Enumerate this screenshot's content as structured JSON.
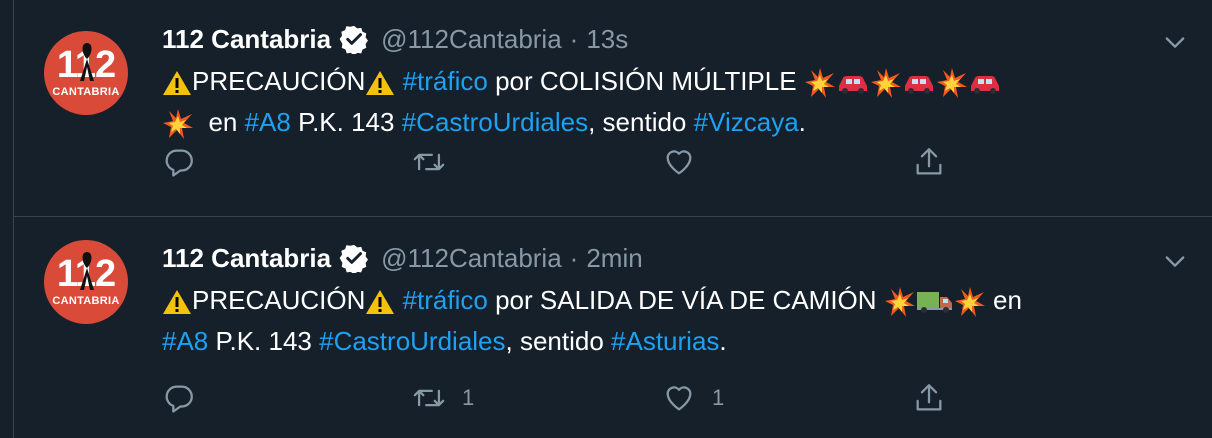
{
  "tweets": [
    {
      "display_name": "112 Cantabria",
      "handle": "@112Cantabria",
      "separator": "·",
      "time": "13s",
      "avatar": {
        "number": "112",
        "label": "CANTABRIA"
      },
      "text": {
        "p1": "PRECAUCIÓN",
        "hashtag1": "#tráfico",
        "p2": " por COLISIÓN MÚLTIPLE ",
        "p3": "  en ",
        "hashtag2": "#A8",
        "p4": " P.K. 143 ",
        "hashtag3": "#CastroUrdiales",
        "p5": ", sentido ",
        "hashtag4": "#Vizcaya",
        "p6": "."
      },
      "retweets": "",
      "likes": ""
    },
    {
      "display_name": "112 Cantabria",
      "handle": "@112Cantabria",
      "separator": "·",
      "time": "2min",
      "avatar": {
        "number": "112",
        "label": "CANTABRIA"
      },
      "text": {
        "p1": "PRECAUCIÓN",
        "hashtag1": "#tráfico",
        "p2": " por SALIDA DE VÍA DE CAMIÓN ",
        "p3": " en ",
        "hashtag2": "#A8",
        "p4": " P.K. 143 ",
        "hashtag3": "#CastroUrdiales",
        "p5": ", sentido ",
        "hashtag4": "#Asturias",
        "p6": "."
      },
      "retweets": "1",
      "likes": "1"
    }
  ],
  "colors": {
    "background": "#15202b",
    "accent": "#1da1f2",
    "muted": "#8899a6",
    "divider": "#38444d",
    "avatar": "#d94a38"
  },
  "icons": [
    "verified-icon",
    "chevron-down-icon",
    "warning-icon",
    "collision-icon",
    "car-icon",
    "truck-icon",
    "reply-icon",
    "retweet-icon",
    "like-icon",
    "share-icon"
  ]
}
